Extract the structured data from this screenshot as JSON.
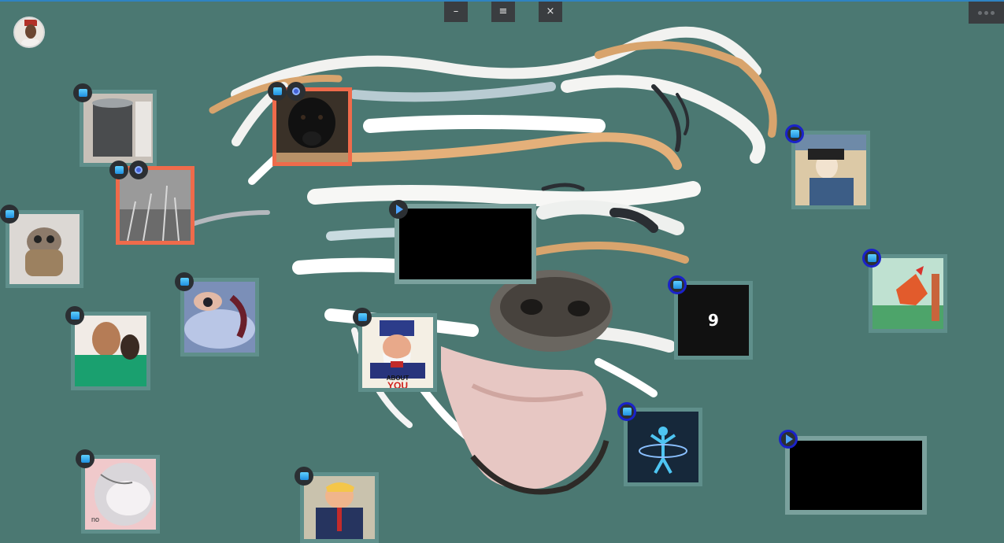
{
  "theme": {
    "background": "#4b7872",
    "selection": "#ef6b4b",
    "badge_ring": "#1a22c9"
  },
  "window_controls": {
    "minimize": "–",
    "menu": "≡",
    "close": "×"
  },
  "cards": {
    "uncle_sam": {
      "line1": "ABOUT",
      "line2": "YOU"
    },
    "bugs_bunny": {
      "caption": "no"
    },
    "nine_gag": {
      "logo": "9"
    }
  },
  "icons": [
    "user-avatar",
    "image-icon",
    "play-icon",
    "collaborator-icon",
    "more-dots-icon"
  ]
}
